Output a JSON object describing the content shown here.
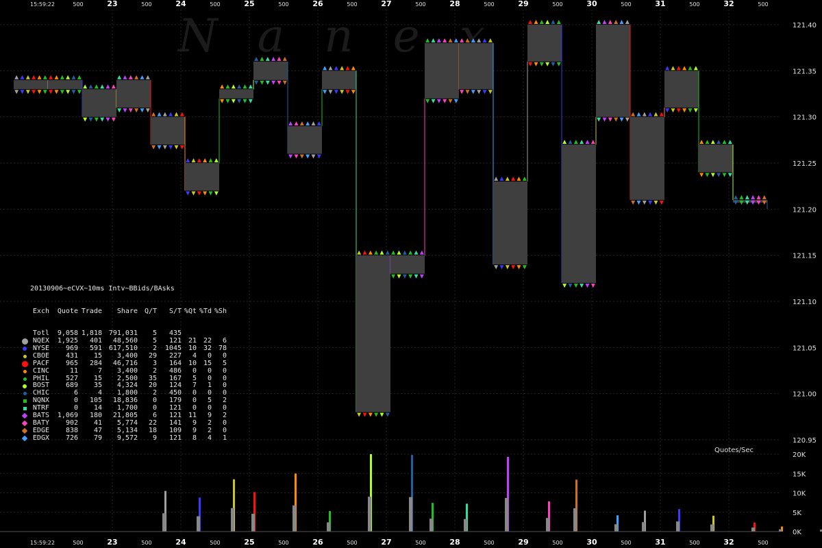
{
  "watermark": "Nanex",
  "stats_title": "20130906~eCVX~10ms Intv~BBids/BAsks",
  "stats_header": [
    "Exch",
    "Quote",
    "Trade",
    "Share",
    "Q/T",
    "S/T",
    "%Qt",
    "%Td",
    "%Sh"
  ],
  "stats_rows": [
    {
      "exch": "Totl",
      "quote": "9,058",
      "trade": "1,818",
      "share": "791,031",
      "qt": "5",
      "st": "435",
      "xq": "",
      "xt": "",
      "xs": "",
      "marker": "none",
      "color": "#ffffff"
    },
    {
      "exch": "NQEX",
      "quote": "1,925",
      "trade": "401",
      "share": "48,560",
      "qt": "5",
      "st": "121",
      "xq": "21",
      "xt": "22",
      "xs": "6",
      "marker": "circle-lg",
      "color": "#a0a0a0"
    },
    {
      "exch": "NYSE",
      "quote": "969",
      "trade": "591",
      "share": "617,510",
      "qt": "2",
      "st": "1045",
      "xq": "10",
      "xt": "32",
      "xs": "78",
      "marker": "circle",
      "color": "#3a3aff"
    },
    {
      "exch": "CBOE",
      "quote": "431",
      "trade": "15",
      "share": "3,400",
      "qt": "29",
      "st": "227",
      "xq": "4",
      "xt": "0",
      "xs": "0",
      "marker": "circle-sm",
      "color": "#c8c820"
    },
    {
      "exch": "PACF",
      "quote": "965",
      "trade": "284",
      "share": "46,716",
      "qt": "3",
      "st": "164",
      "xq": "10",
      "xt": "15",
      "xs": "5",
      "marker": "circle-lg",
      "color": "#ff1010"
    },
    {
      "exch": "CINC",
      "quote": "11",
      "trade": "7",
      "share": "3,400",
      "qt": "2",
      "st": "486",
      "xq": "0",
      "xt": "0",
      "xs": "0",
      "marker": "circle-sm",
      "color": "#ff8c00"
    },
    {
      "exch": "PHIL",
      "quote": "527",
      "trade": "15",
      "share": "2,500",
      "qt": "35",
      "st": "167",
      "xq": "5",
      "xt": "0",
      "xs": "0",
      "marker": "circle-sm",
      "color": "#20c020"
    },
    {
      "exch": "BOST",
      "quote": "689",
      "trade": "35",
      "share": "4,324",
      "qt": "20",
      "st": "124",
      "xq": "7",
      "xt": "1",
      "xs": "0",
      "marker": "circle",
      "color": "#b0ff20"
    },
    {
      "exch": "CHIC",
      "quote": "6",
      "trade": "4",
      "share": "1,800",
      "qt": "2",
      "st": "450",
      "xq": "0",
      "xt": "0",
      "xs": "0",
      "marker": "circle-sm",
      "color": "#2060a0"
    },
    {
      "exch": "NQNX",
      "quote": "0",
      "trade": "105",
      "share": "18,836",
      "qt": "0",
      "st": "179",
      "xq": "0",
      "xt": "5",
      "xs": "2",
      "marker": "square",
      "color": "#20c020"
    },
    {
      "exch": "NTRF",
      "quote": "0",
      "trade": "14",
      "share": "1,700",
      "qt": "0",
      "st": "121",
      "xq": "0",
      "xt": "0",
      "xs": "0",
      "marker": "square",
      "color": "#30e0a0"
    },
    {
      "exch": "BATS",
      "quote": "1,069",
      "trade": "180",
      "share": "21,805",
      "qt": "6",
      "st": "121",
      "xq": "11",
      "xt": "9",
      "xs": "2",
      "marker": "diamond",
      "color": "#c040ff"
    },
    {
      "exch": "BATY",
      "quote": "902",
      "trade": "41",
      "share": "5,774",
      "qt": "22",
      "st": "141",
      "xq": "9",
      "xt": "2",
      "xs": "0",
      "marker": "diamond",
      "color": "#ff40c0"
    },
    {
      "exch": "EDGE",
      "quote": "838",
      "trade": "47",
      "share": "5,134",
      "qt": "18",
      "st": "109",
      "xq": "9",
      "xt": "2",
      "xs": "0",
      "marker": "diamond",
      "color": "#d07020"
    },
    {
      "exch": "EDGX",
      "quote": "726",
      "trade": "79",
      "share": "9,572",
      "qt": "9",
      "st": "121",
      "xq": "8",
      "xt": "4",
      "xs": "1",
      "marker": "diamond",
      "color": "#40a0ff"
    }
  ],
  "qps_label": "Quotes/Sec",
  "colors": {
    "band": "#3f3f3f",
    "grid": "#262626",
    "axis_text": "#e0e0e0",
    "bold_tick": "#ffffff"
  },
  "chart_data": [
    {
      "type": "area",
      "title": "",
      "x_start_label": "15:59:22",
      "x_ticks": [
        "15:59:22",
        "500",
        "23",
        "500",
        "24",
        "500",
        "25",
        "500",
        "26",
        "500",
        "27",
        "500",
        "28",
        "500",
        "29",
        "500",
        "30",
        "500",
        "31",
        "500",
        "32",
        "500"
      ],
      "ylim": [
        120.95,
        121.4
      ],
      "y_ticks": [
        "121.40",
        "121.35",
        "121.30",
        "121.25",
        "121.20",
        "121.15",
        "121.10",
        "121.05",
        "121.00",
        "120.95"
      ],
      "series": [
        {
          "values_x": [
            0,
            0.5,
            1,
            1.5,
            2,
            2.5,
            3,
            3.5,
            4,
            4.5,
            5,
            5.5,
            6,
            6.5,
            7,
            7.5,
            8,
            8.5,
            9,
            9.5,
            10,
            10.5,
            11
          ],
          "bid": [
            121.33,
            121.33,
            121.3,
            121.31,
            121.27,
            121.22,
            121.32,
            121.34,
            121.26,
            121.33,
            120.98,
            121.13,
            121.32,
            121.33,
            121.14,
            121.36,
            121.12,
            121.3,
            121.21,
            121.31,
            121.24,
            121.21,
            121.2
          ],
          "ask": [
            121.34,
            121.34,
            121.33,
            121.34,
            121.3,
            121.25,
            121.33,
            121.36,
            121.29,
            121.35,
            121.15,
            121.15,
            121.38,
            121.38,
            121.23,
            121.4,
            121.27,
            121.4,
            121.3,
            121.35,
            121.27,
            121.21,
            121.21
          ]
        }
      ]
    },
    {
      "type": "bar",
      "title": "Quotes/Sec",
      "ylim": [
        0,
        20000
      ],
      "y_ticks": [
        "20K",
        "15K",
        "10K",
        "5K",
        "0K"
      ],
      "x": [
        1.0,
        1.5,
        2.0,
        2.3,
        2.9,
        3.4,
        4.0,
        4.6,
        4.9,
        5.4,
        6.0,
        6.6,
        7.0,
        7.6,
        8.0,
        8.5,
        9.0,
        9.6,
        10.0,
        10.6
      ],
      "values": [
        10500,
        8800,
        13500,
        10200,
        15000,
        5300,
        20000,
        19800,
        7400,
        7200,
        19300,
        7800,
        13400,
        4200,
        5400,
        5800,
        4100,
        2300,
        1300,
        1100
      ]
    }
  ]
}
